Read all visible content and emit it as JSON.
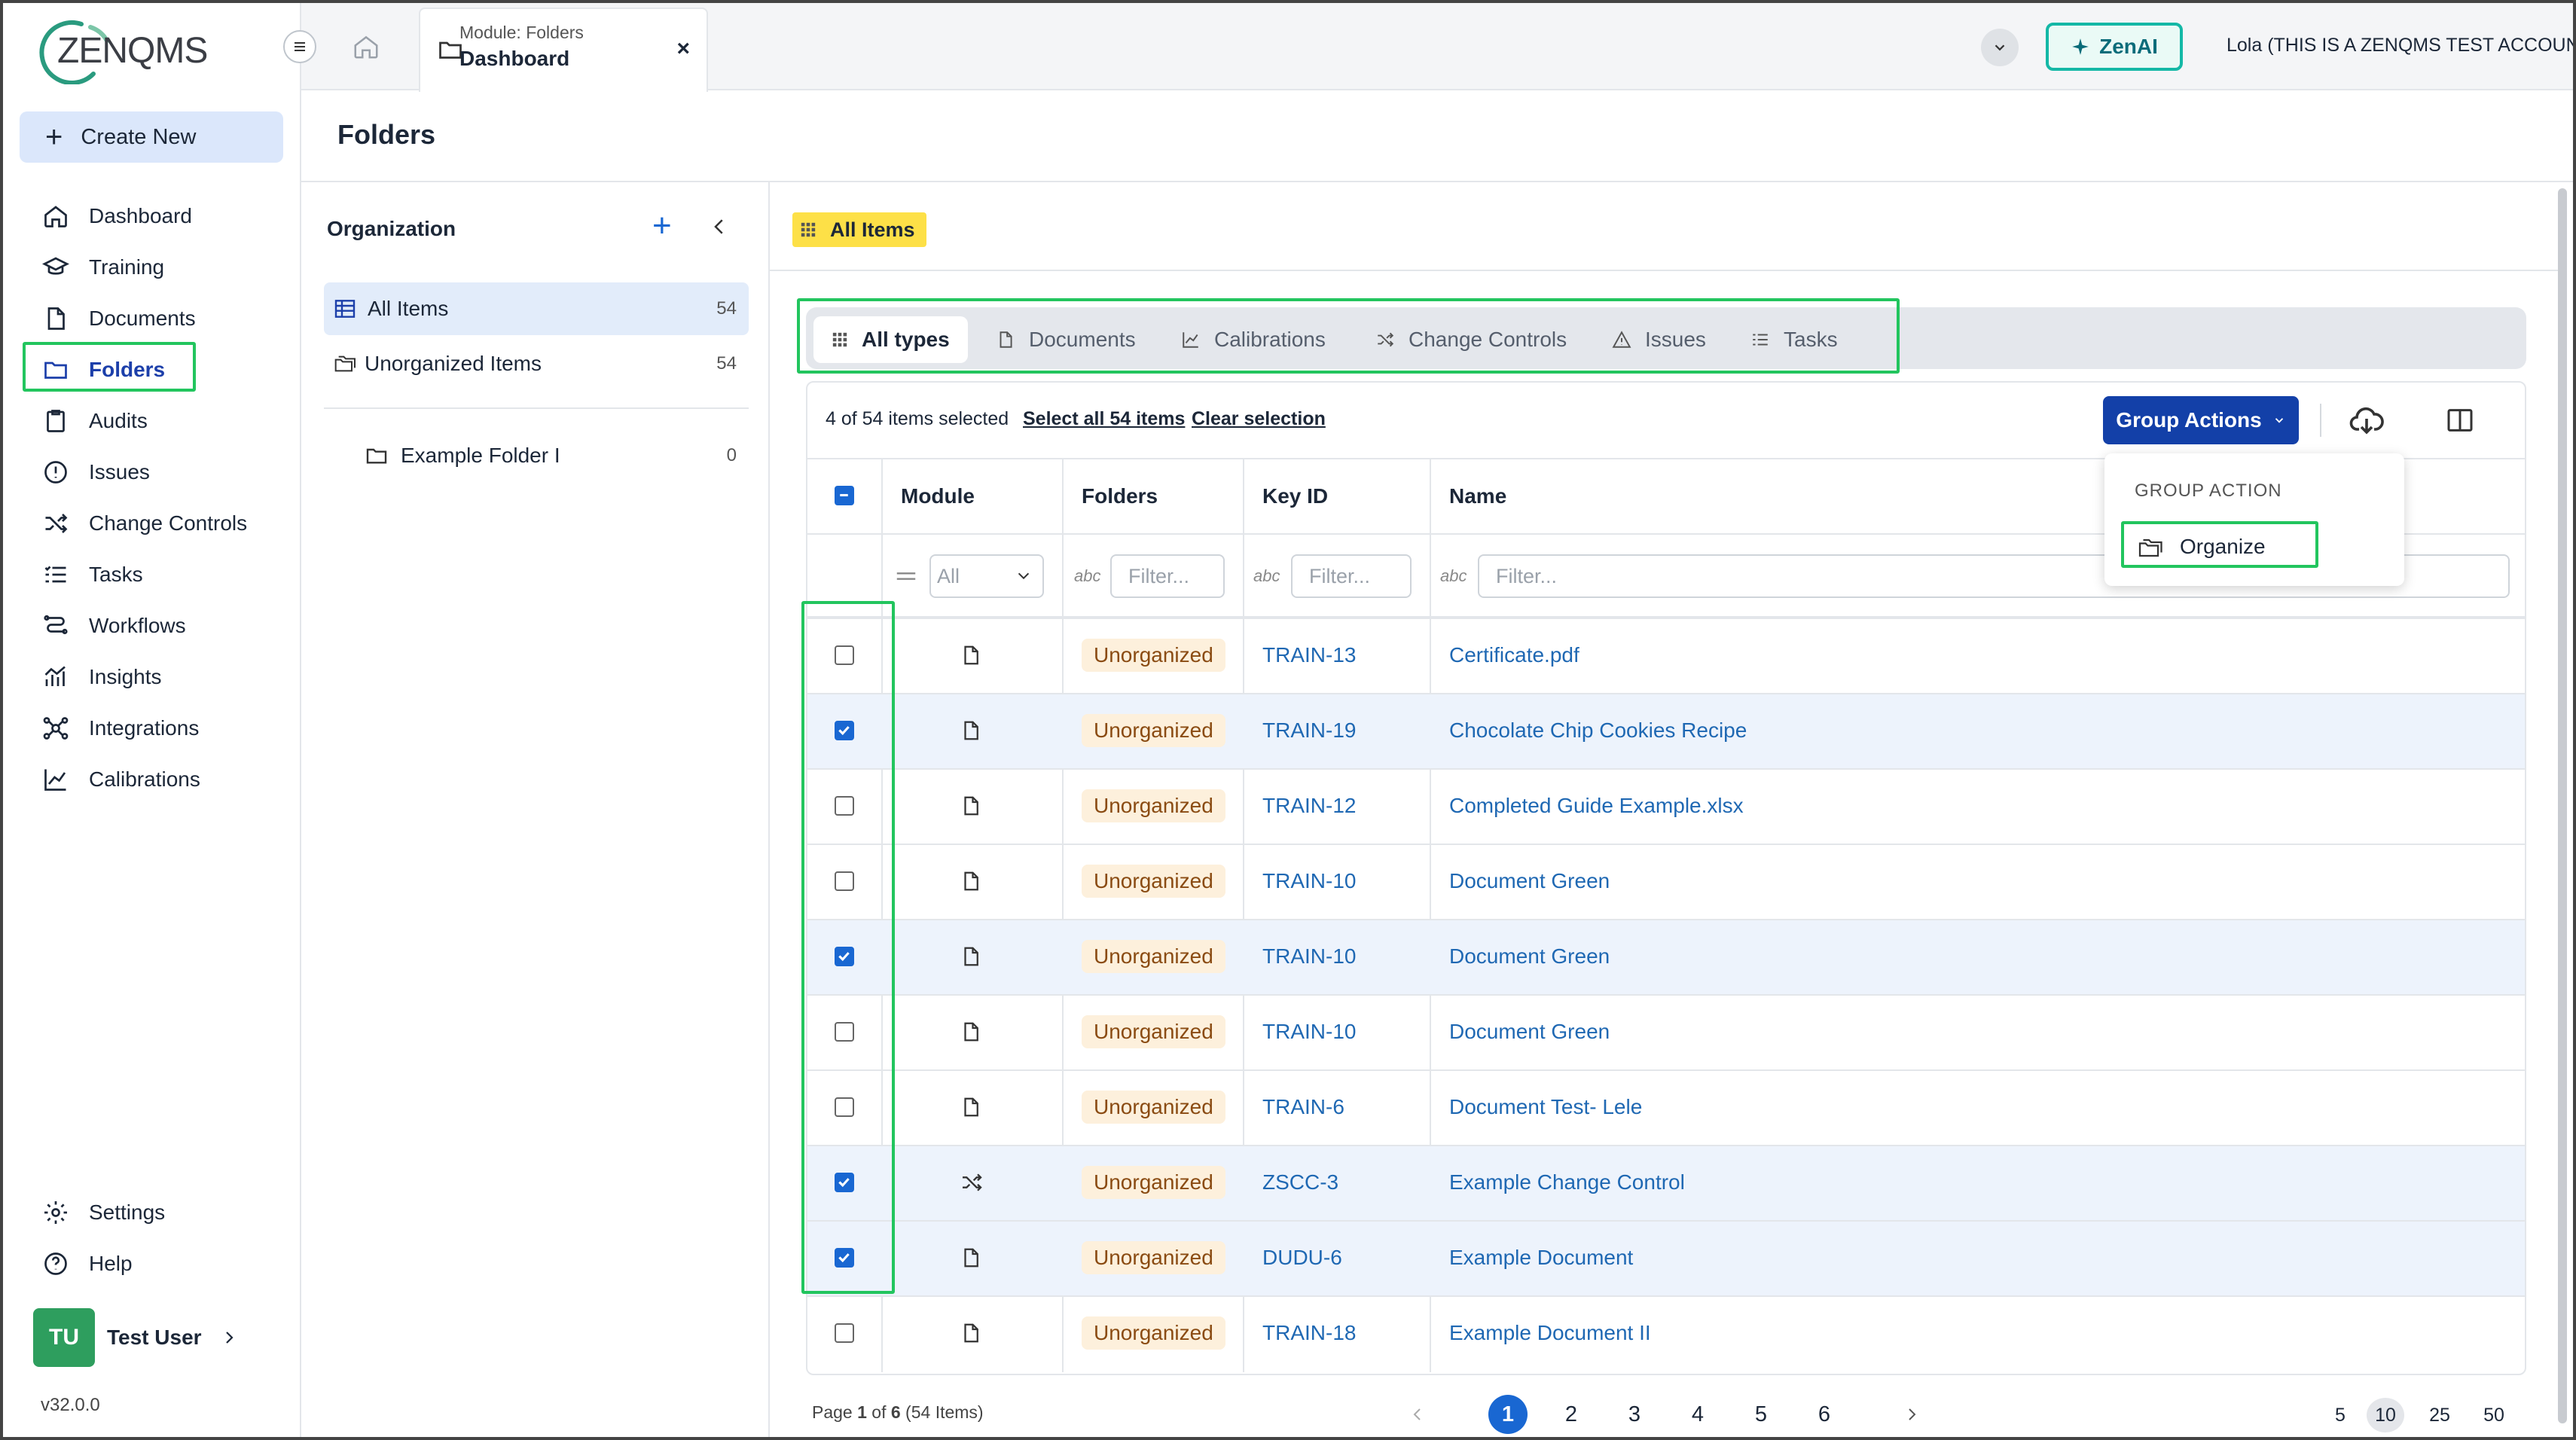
{
  "brand": {
    "logo_text": "ZENQMS"
  },
  "sidebar": {
    "create_label": "Create New",
    "items": [
      {
        "label": "Dashboard",
        "icon": "home-icon"
      },
      {
        "label": "Training",
        "icon": "graduation-cap-icon"
      },
      {
        "label": "Documents",
        "icon": "document-icon"
      },
      {
        "label": "Folders",
        "icon": "folder-icon"
      },
      {
        "label": "Audits",
        "icon": "clipboard-icon"
      },
      {
        "label": "Issues",
        "icon": "warning-icon"
      },
      {
        "label": "Change Controls",
        "icon": "shuffle-icon"
      },
      {
        "label": "Tasks",
        "icon": "task-list-icon"
      },
      {
        "label": "Workflows",
        "icon": "workflow-icon"
      },
      {
        "label": "Insights",
        "icon": "insights-icon"
      },
      {
        "label": "Integrations",
        "icon": "integrations-icon"
      },
      {
        "label": "Calibrations",
        "icon": "chart-icon"
      }
    ],
    "settings_label": "Settings",
    "help_label": "Help",
    "user": {
      "initials": "TU",
      "name": "Test User"
    },
    "version": "v32.0.0"
  },
  "topbar": {
    "tab_module": "Module: Folders",
    "tab_title": "Dashboard",
    "zenai_label": "ZenAI",
    "account_label": "Lola (THIS IS A ZENQMS TEST ACCOUNT)"
  },
  "page": {
    "title": "Folders"
  },
  "org_panel": {
    "title": "Organization",
    "all_items": {
      "label": "All Items",
      "count": "54"
    },
    "unorganized": {
      "label": "Unorganized Items",
      "count": "54"
    },
    "folders": [
      {
        "label": "Example Folder I",
        "count": "0"
      }
    ]
  },
  "content": {
    "badge_label": "All Items",
    "type_tabs": [
      "All types",
      "Documents",
      "Calibrations",
      "Change Controls",
      "Issues",
      "Tasks"
    ],
    "selection_text": "4 of 54 items selected",
    "select_all_label": "Select all 54 items",
    "clear_label": "Clear selection",
    "group_actions_label": "Group Actions",
    "dropdown": {
      "heading": "GROUP ACTION",
      "organize_label": "Organize"
    },
    "columns": {
      "module": "Module",
      "folders": "Folders",
      "key_id": "Key ID",
      "name": "Name"
    },
    "filters": {
      "module_placeholder": "All",
      "placeholder": "Filter..."
    },
    "rows": [
      {
        "checked": false,
        "module_icon": "document-icon",
        "folder": "Unorganized",
        "key": "TRAIN-13",
        "name": "Certificate.pdf"
      },
      {
        "checked": true,
        "module_icon": "document-icon",
        "folder": "Unorganized",
        "key": "TRAIN-19",
        "name": "Chocolate Chip Cookies Recipe"
      },
      {
        "checked": false,
        "module_icon": "document-icon",
        "folder": "Unorganized",
        "key": "TRAIN-12",
        "name": "Completed Guide Example.xlsx"
      },
      {
        "checked": false,
        "module_icon": "document-icon",
        "folder": "Unorganized",
        "key": "TRAIN-10",
        "name": "Document Green"
      },
      {
        "checked": true,
        "module_icon": "document-icon",
        "folder": "Unorganized",
        "key": "TRAIN-10",
        "name": "Document Green"
      },
      {
        "checked": false,
        "module_icon": "document-icon",
        "folder": "Unorganized",
        "key": "TRAIN-10",
        "name": "Document Green"
      },
      {
        "checked": false,
        "module_icon": "document-icon",
        "folder": "Unorganized",
        "key": "TRAIN-6",
        "name": "Document Test- Lele"
      },
      {
        "checked": true,
        "module_icon": "shuffle-icon",
        "folder": "Unorganized",
        "key": "ZSCC-3",
        "name": "Example Change Control"
      },
      {
        "checked": true,
        "module_icon": "document-icon",
        "folder": "Unorganized",
        "key": "DUDU-6",
        "name": "Example Document"
      },
      {
        "checked": false,
        "module_icon": "document-icon",
        "folder": "Unorganized",
        "key": "TRAIN-18",
        "name": "Example Document II"
      }
    ],
    "pagination": {
      "summary_prefix": "Page ",
      "current": "1",
      "summary_mid": " of ",
      "total_pages": "6",
      "summary_suffix": " (54 Items)",
      "pages": [
        "1",
        "2",
        "3",
        "4",
        "5",
        "6"
      ],
      "page_sizes": [
        "5",
        "10",
        "25",
        "50"
      ],
      "selected_size": "10"
    }
  },
  "colors": {
    "accent": "#1340a8",
    "highlight_box": "#22c55e",
    "badge_yellow": "#fde047",
    "link": "#1f68b3"
  }
}
